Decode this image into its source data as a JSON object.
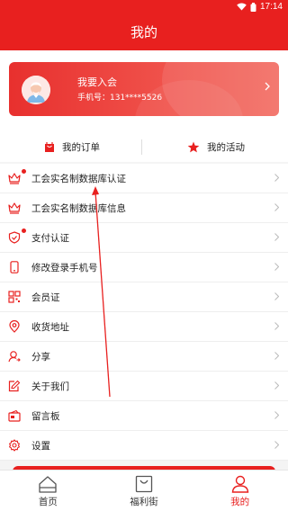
{
  "status_bar": {
    "time": "17:14"
  },
  "header": {
    "title": "我的"
  },
  "profile": {
    "join_label": "我要入会",
    "phone_label": "手机号：131****5526"
  },
  "tabs": [
    {
      "label": "我的订单",
      "icon": "shopping-bag-icon"
    },
    {
      "label": "我的活动",
      "icon": "star-icon"
    }
  ],
  "menu": [
    {
      "label": "工会实名制数据库认证",
      "icon": "crown-icon",
      "badge": true
    },
    {
      "label": "工会实名制数据库信息",
      "icon": "crown-icon",
      "badge": false
    },
    {
      "label": "支付认证",
      "icon": "shield-check-icon",
      "badge": true
    },
    {
      "label": "修改登录手机号",
      "icon": "phone-icon",
      "badge": false
    },
    {
      "label": "会员证",
      "icon": "qr-code-icon",
      "badge": false
    },
    {
      "label": "收货地址",
      "icon": "location-pin-icon",
      "badge": false
    },
    {
      "label": "分享",
      "icon": "share-icon",
      "badge": false
    },
    {
      "label": "关于我们",
      "icon": "edit-note-icon",
      "badge": false
    },
    {
      "label": "留言板",
      "icon": "message-board-icon",
      "badge": false
    },
    {
      "label": "设置",
      "icon": "gear-icon",
      "badge": false
    }
  ],
  "bottom_nav": [
    {
      "label": "首页",
      "icon": "home-icon",
      "active": false
    },
    {
      "label": "福利街",
      "icon": "shopping-bag-icon",
      "active": false
    },
    {
      "label": "我的",
      "icon": "person-icon",
      "active": true
    }
  ],
  "colors": {
    "brand_red": "#e8201f",
    "text": "#222222",
    "divider": "#eeeeee"
  }
}
